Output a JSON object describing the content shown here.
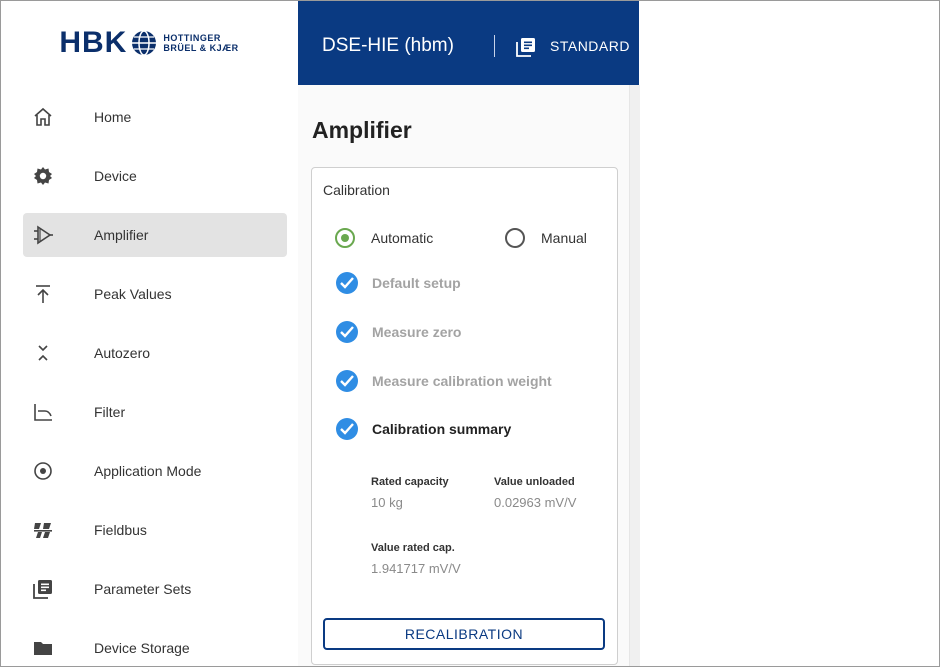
{
  "brand": {
    "name": "HBK",
    "sub_line1": "HOTTINGER",
    "sub_line2": "BRÜEL & KJÆR",
    "color": "#0b2f6b"
  },
  "sidebar": {
    "items": [
      {
        "label": "Home",
        "icon": "home-icon",
        "active": false
      },
      {
        "label": "Device",
        "icon": "gear-icon",
        "active": false
      },
      {
        "label": "Amplifier",
        "icon": "amplifier-icon",
        "active": true
      },
      {
        "label": "Peak Values",
        "icon": "peak-icon",
        "active": false
      },
      {
        "label": "Autozero",
        "icon": "autozero-icon",
        "active": false
      },
      {
        "label": "Filter",
        "icon": "filter-icon",
        "active": false
      },
      {
        "label": "Application Mode",
        "icon": "target-icon",
        "active": false
      },
      {
        "label": "Fieldbus",
        "icon": "fieldbus-icon",
        "active": false
      },
      {
        "label": "Parameter Sets",
        "icon": "parameter-sets-icon",
        "active": false
      },
      {
        "label": "Device Storage",
        "icon": "folder-icon",
        "active": false
      }
    ]
  },
  "header": {
    "device": "DSE-HIE (hbm)",
    "parameter_set": "STANDARD",
    "background": "#0a3a82"
  },
  "main": {
    "title": "Amplifier",
    "calibration": {
      "title": "Calibration",
      "mode_automatic": "Automatic",
      "mode_manual": "Manual",
      "selected_mode": "Automatic",
      "steps": [
        {
          "label": "Default setup",
          "done": true,
          "current": false
        },
        {
          "label": "Measure zero",
          "done": true,
          "current": false
        },
        {
          "label": "Measure calibration weight",
          "done": true,
          "current": false
        },
        {
          "label": "Calibration summary",
          "done": true,
          "current": true
        }
      ],
      "summary": {
        "rated_capacity_label": "Rated capacity",
        "rated_capacity_value": "10 kg",
        "value_unloaded_label": "Value unloaded",
        "value_unloaded_value": "0.02963 mV/V",
        "value_rated_cap_label": "Value rated cap.",
        "value_rated_cap_value": "1.941717 mV/V"
      },
      "recalibration_button": "RECALIBRATION"
    }
  },
  "colors": {
    "accent": "#0a3a82",
    "check": "#2f8de4",
    "radio_on": "#6aa84f",
    "active_nav": "#e3e3e3"
  }
}
